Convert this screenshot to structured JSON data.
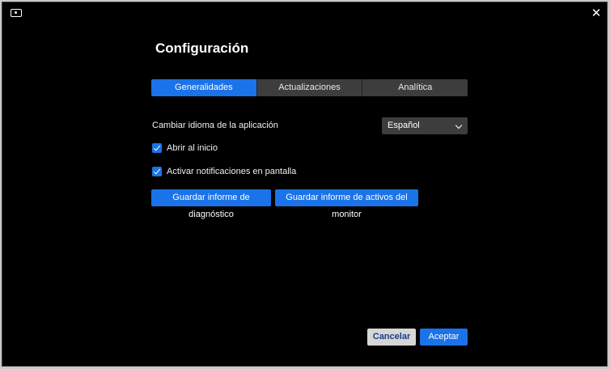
{
  "header": {
    "title": "Configuración",
    "app_icon": "monitor-icon",
    "close_label": "✕"
  },
  "tabs": [
    {
      "label": "Generalidades",
      "active": true
    },
    {
      "label": "Actualizaciones",
      "active": false
    },
    {
      "label": "Analítica",
      "active": false
    }
  ],
  "settings": {
    "language_label": "Cambiar idioma de la aplicación",
    "language_value": "Español",
    "open_at_start_label": "Abrir al inicio",
    "open_at_start_checked": true,
    "notifications_label": "Activar notificaciones en pantalla",
    "notifications_checked": true
  },
  "actions": {
    "diagnostic_label": "Guardar informe de diagnóstico",
    "asset_label": "Guardar informe de activos del monitor"
  },
  "footer": {
    "cancel_label": "Cancelar",
    "accept_label": "Aceptar"
  },
  "colors": {
    "accent": "#1a73e8",
    "background": "#000000",
    "tab_inactive": "#3d3d3d"
  }
}
